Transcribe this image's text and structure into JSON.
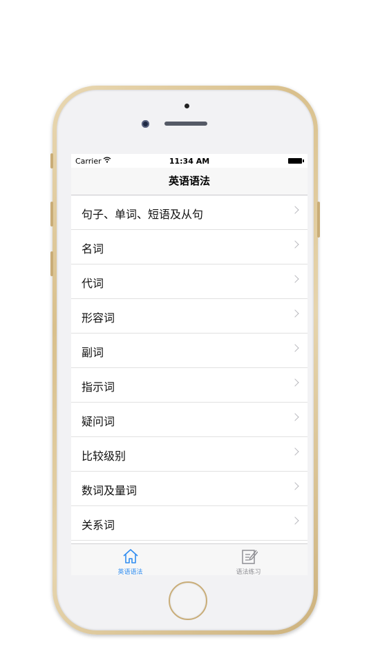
{
  "status_bar": {
    "carrier": "Carrier",
    "time": "11:34 AM"
  },
  "navbar": {
    "title": "英语语法"
  },
  "list": {
    "items": [
      "句子、单词、短语及从句",
      "名词",
      "代词",
      "形容词",
      "副词",
      "指示词",
      "疑问词",
      "比较级别",
      "数词及量词",
      "关系词"
    ]
  },
  "tabbar": {
    "tabs": [
      {
        "label": "英语语法",
        "icon": "home-icon",
        "selected": true
      },
      {
        "label": "语法练习",
        "icon": "edit-note-icon",
        "selected": false
      }
    ],
    "active_color": "#2f8cf0",
    "inactive_color": "#8e8e93"
  }
}
